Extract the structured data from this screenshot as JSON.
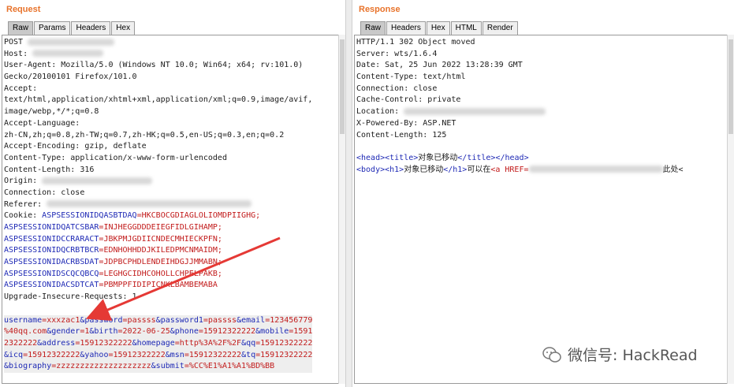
{
  "request": {
    "title": "Request",
    "tabs": [
      "Raw",
      "Params",
      "Headers",
      "Hex"
    ],
    "lines": [
      {
        "k": "POST ",
        "v": "",
        "blur": 110
      },
      {
        "k": "Host: ",
        "v": "",
        "blur": 90
      },
      {
        "k": "User-Agent: Mozilla/5.0 (Windows NT 10.0; Win64; x64; rv:101.0)",
        "v": ""
      },
      {
        "k": "Gecko/20100101 Firefox/101.0",
        "v": ""
      },
      {
        "k": "Accept:",
        "v": ""
      },
      {
        "k": "text/html,application/xhtml+xml,application/xml;q=0.9,image/avif,",
        "v": ""
      },
      {
        "k": "image/webp,*/*;q=0.8",
        "v": ""
      },
      {
        "k": "Accept-Language:",
        "v": ""
      },
      {
        "k": "zh-CN,zh;q=0.8,zh-TW;q=0.7,zh-HK;q=0.5,en-US;q=0.3,en;q=0.2",
        "v": ""
      },
      {
        "k": "Accept-Encoding: gzip, deflate",
        "v": ""
      },
      {
        "k": "Content-Type: application/x-www-form-urlencoded",
        "v": ""
      },
      {
        "k": "Content-Length: 316",
        "v": ""
      },
      {
        "k": "Origin: ",
        "v": "",
        "blur": 140
      },
      {
        "k": "Connection: close",
        "v": ""
      },
      {
        "k": "Referer: ",
        "v": "",
        "blur": 260
      },
      {
        "k": "Cookie: ",
        "ck": "ASPSESSIONIDQASBTDAQ",
        "cv": "=HKCBOCGDIAGLOLIOMDPIIGHG;"
      },
      {
        "k": "",
        "ck": "ASPSESSIONIDQATCSBAR",
        "cv": "=INJHEGGDDDEIEGFIDLGIHAMP;"
      },
      {
        "k": "",
        "ck": "ASPSESSIONIDCCRARACT",
        "cv": "=JBKPMJGDIICNDECMHIECKPFN;"
      },
      {
        "k": "",
        "ck": "ASPSESSIONIDQCRBTBCR",
        "cv": "=EDNHOHHDDJKILEDPMCNMAIDM;"
      },
      {
        "k": "",
        "ck": "ASPSESSIONIDACRBSDAT",
        "cv": "=JDPBCPHDLENDEIHDGJJMMABN;"
      },
      {
        "k": "",
        "ck": "ASPSESSIONIDSCQCQBCQ",
        "cv": "=LEGHGCIDHCOHOLLCHPELPAKB;"
      },
      {
        "k": "",
        "ck": "ASPSESSIONIDACSDTCAT",
        "cv": "=PBMPPFIDIPICNKLBAMBEMABA"
      },
      {
        "k": "Upgrade-Insecure-Requests: 1",
        "v": ""
      },
      {
        "k": "",
        "v": ""
      }
    ],
    "body_lines": [
      [
        [
          "username",
          "=xxxzac1"
        ],
        [
          "&password",
          "=passss"
        ],
        [
          "&password1",
          "=passss"
        ],
        [
          "&email",
          "=123456779"
        ]
      ],
      [
        [
          "",
          "%40qq.com"
        ],
        [
          "&gender",
          "=1"
        ],
        [
          "&birth",
          "=2022-06-25"
        ],
        [
          "&phone",
          "=15912322222"
        ],
        [
          "&mobile",
          "=1591"
        ]
      ],
      [
        [
          "",
          "2322222"
        ],
        [
          "&address",
          "=15912322222"
        ],
        [
          "&homepage",
          "=http%3A%2F%2F"
        ],
        [
          "&qq",
          "=15912322222"
        ]
      ],
      [
        [
          "&icq",
          "=15912322222"
        ],
        [
          "&yahoo",
          "=15912322222"
        ],
        [
          "&msn",
          "=15912322222"
        ],
        [
          "&tq",
          "=15912322222"
        ]
      ],
      [
        [
          "&biography",
          "=zzzzzzzzzzzzzzzzzzzz"
        ],
        [
          "&submit",
          "=%CC%E1%A1%A1%BD%BB"
        ]
      ]
    ]
  },
  "response": {
    "title": "Response",
    "tabs": [
      "Raw",
      "Headers",
      "Hex",
      "HTML",
      "Render"
    ],
    "lines": [
      "HTTP/1.1 302 Object moved",
      "Server: wts/1.6.4",
      "Date: Sat, 25 Jun 2022 13:28:39 GMT",
      "Content-Type: text/html",
      "Connection: close",
      "Cache-Control: private",
      "Location: ",
      "X-Powered-By: ASP.NET",
      "Content-Length: 125",
      ""
    ],
    "html_line1": {
      "o1": "<head>",
      "o2": "<title>",
      "text": "对象已移动",
      "c2": "</title>",
      "c1": "</head>"
    },
    "html_line2": {
      "o1": "<body>",
      "o2": "<h1>",
      "text": "对象已移动",
      "c2": "</h1>",
      "text2": "可以在",
      "o3": "<a HREF=",
      "tail": "此处<"
    }
  },
  "watermark": "微信号: HackRead",
  "colors": {
    "title": "#e8732b",
    "key": "#1f2ab5",
    "value": "#c21c1c",
    "arrow": "#e53935"
  }
}
